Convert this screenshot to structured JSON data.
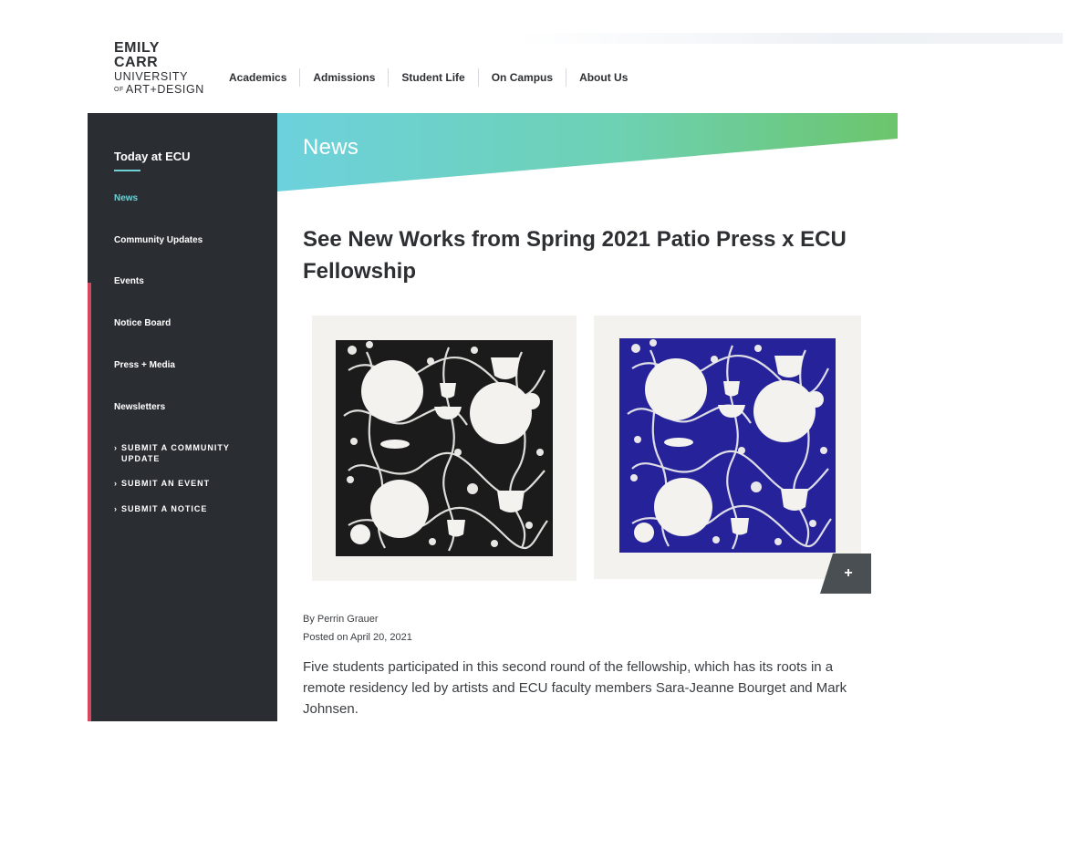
{
  "logo": {
    "line1": "EMILY",
    "line2": "CARR",
    "line3": "UNIVERSITY",
    "line4_prefix": "OF",
    "line4": "ART+DESIGN"
  },
  "topnav": {
    "items": [
      "Academics",
      "Admissions",
      "Student Life",
      "On Campus",
      "About Us"
    ]
  },
  "sidebar": {
    "title": "Today at ECU",
    "items": [
      "News",
      "Community Updates",
      "Events",
      "Notice Board",
      "Press + Media",
      "Newsletters"
    ],
    "links": [
      "SUBMIT A COMMUNITY UPDATE",
      "SUBMIT AN EVENT",
      "SUBMIT A NOTICE"
    ]
  },
  "banner": {
    "title": "News"
  },
  "article": {
    "title": "See New Works from Spring 2021 Patio Press x ECU Fellowship",
    "byline": "By Perrin Grauer",
    "posted": "Posted on April 20, 2021",
    "body": "Five students participated in this second round of the fellowship, which has its roots in a remote residency led by artists and ECU faculty members Sara-Jeanne Bourget and Mark Johnsen.",
    "zoom_label": "+"
  },
  "colors": {
    "sidebar_bg": "#2a2e33",
    "accent_teal": "#6fd0d6",
    "accent_green": "#6cc56b",
    "accent_red": "#d7485e",
    "print_black": "#1b1b1b",
    "print_blue": "#26239a"
  }
}
